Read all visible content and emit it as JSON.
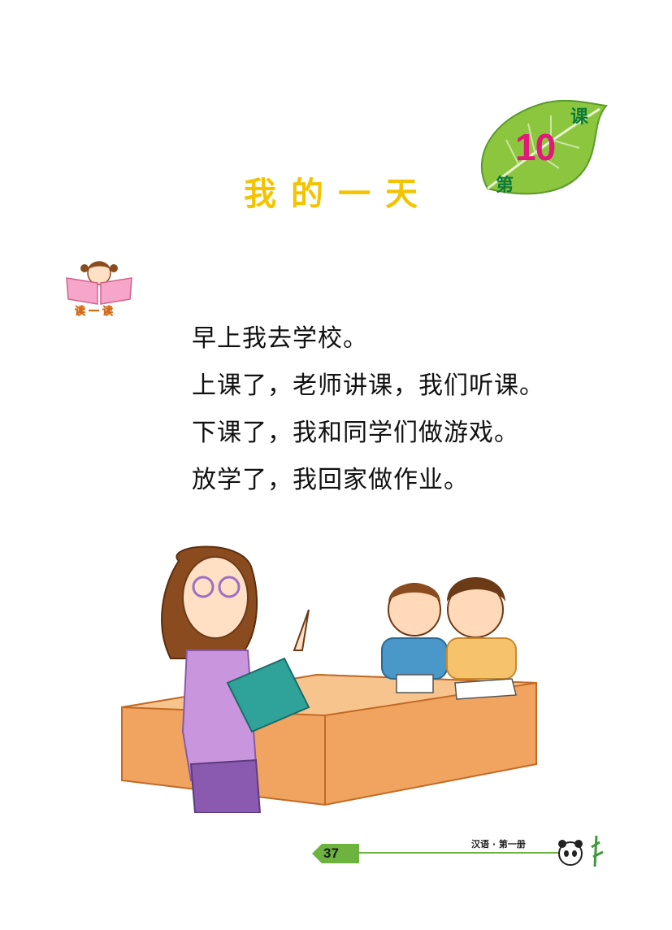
{
  "badge": {
    "ke": "课",
    "number": "10",
    "di": "第"
  },
  "title": "我的一天",
  "read_label": "读一读",
  "lines": [
    "早上我去学校。",
    "上课了，老师讲课，我们听课。",
    "下课了，我和同学们做游戏。",
    "放学了，我回家做作业。"
  ],
  "footer": {
    "page": "37",
    "book": "汉语 · 第一册"
  },
  "colors": {
    "leaf": "#8cc63f",
    "title": "#f2c400",
    "number": "#e3187b",
    "badge_text": "#0b7a3a",
    "footer_line": "#6db33f"
  },
  "icons": {
    "badge": "leaf-icon",
    "read": "girl-reading-book-icon",
    "footer": "panda-bamboo-icon"
  }
}
